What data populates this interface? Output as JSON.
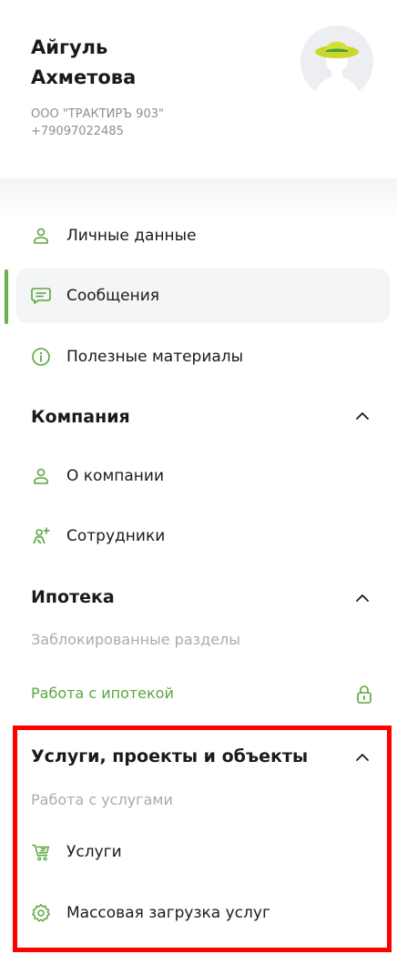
{
  "profile": {
    "first_name": "Айгуль",
    "last_name": "Ахметова",
    "company": "ООО \"ТРАКТИРЪ 903\"",
    "phone": "+79097022485"
  },
  "menu": [
    {
      "label": "Личные данные",
      "icon": "person-icon"
    },
    {
      "label": "Сообщения",
      "icon": "message-icon",
      "active": true
    },
    {
      "label": "Полезные материалы",
      "icon": "info-icon"
    }
  ],
  "company_section": {
    "title": "Компания",
    "items": [
      {
        "label": "О компании",
        "icon": "person-icon"
      },
      {
        "label": "Сотрудники",
        "icon": "add-user-icon"
      }
    ]
  },
  "mortgage_section": {
    "title": "Ипотека",
    "caption": "Заблокированные разделы",
    "link": "Работа с ипотекой"
  },
  "services_section": {
    "title": "Услуги, проекты и объекты",
    "caption": "Работа с услугами",
    "items": [
      {
        "label": "Услуги",
        "icon": "cart-icon"
      },
      {
        "label": "Массовая загрузка услуг",
        "icon": "gear-icon"
      }
    ]
  },
  "colors": {
    "accent_green": "#5aa63c",
    "highlight_red": "#ff0000"
  }
}
